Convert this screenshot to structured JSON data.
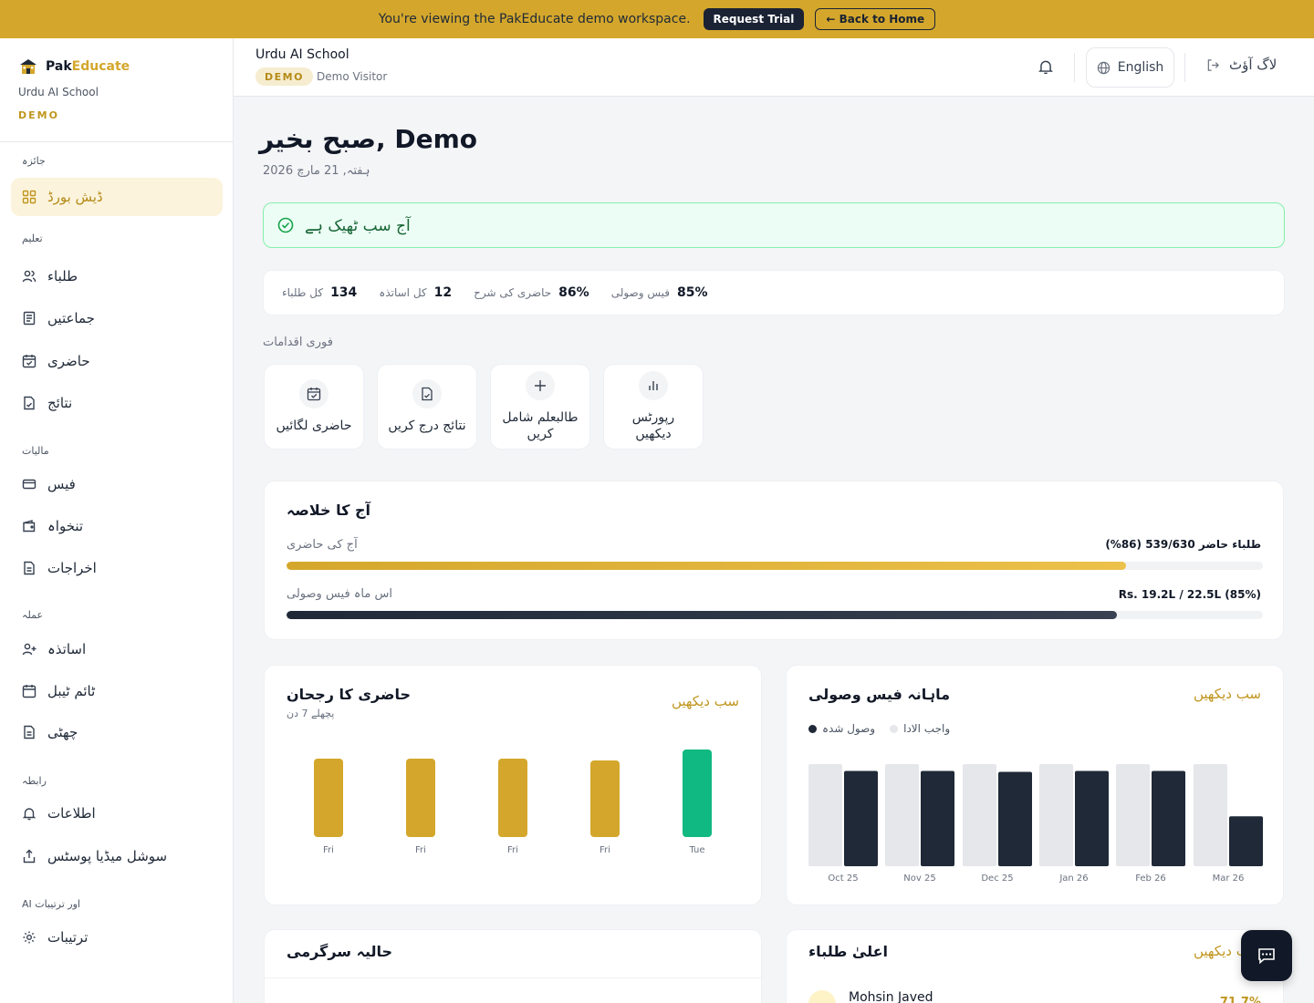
{
  "banner": {
    "message": "You're viewing the PakEducate demo workspace.",
    "request_trial": "Request Trial",
    "back_home": "← Back to Home"
  },
  "brand": {
    "name_part1": "Pak",
    "name_part2": "Educate",
    "school": "Urdu AI School",
    "badge": "DEMO"
  },
  "sidebar": {
    "sections": {
      "overview": "جائزہ",
      "education": "تعلیم",
      "finance": "مالیات",
      "staff": "عملہ",
      "contact": "رابطہ",
      "settings": "AI اور ترتیبات"
    },
    "items": {
      "dashboard": "ڈیش بورڈ",
      "students": "طلباء",
      "classes": "جماعتیں",
      "attendance": "حاضری",
      "results": "نتائج",
      "fees": "فیس",
      "salary": "تنخواہ",
      "expenses": "اخراجات",
      "teachers": "اساتذہ",
      "timetable": "ٹائم ٹیبل",
      "leave": "چھٹی",
      "notifications": "اطلاعات",
      "social": "سوشل میڈیا پوسٹس",
      "settings": "ترتیبات"
    }
  },
  "header": {
    "school": "Urdu AI School",
    "badge": "DEMO",
    "visitor": "Demo Visitor",
    "language": "English",
    "logout": "لاگ آؤٹ"
  },
  "greeting": {
    "text": "صبح بخیر, Demo",
    "date": "ہفتہ, 21 مارچ 2026"
  },
  "status_banner": "آج سب ٹھیک ہے",
  "stats": [
    {
      "label": "کل طلباء",
      "value": "134"
    },
    {
      "label": "کل اساتذہ",
      "value": "12"
    },
    {
      "label": "حاضری کی شرح",
      "value": "86%"
    },
    {
      "label": "فیس وصولی",
      "value": "85%"
    }
  ],
  "quick_actions": {
    "title": "فوری اقدامات",
    "items": [
      "حاضری لگائیں",
      "نتائج درج کریں",
      "طالبعلم شامل کریں",
      "رپورٹس دیکھیں"
    ]
  },
  "summary": {
    "title": "آج کا خلاصہ",
    "attendance_label": "آج کی حاضری",
    "attendance_value": "طلباء حاضر 539/630 (86%)",
    "attendance_fraction": 0.86,
    "fees_label": "اس ماہ فیس وصولی",
    "fees_value": "Rs. 19.2L / 22.5L (85%)",
    "fees_fraction": 0.85
  },
  "attendance_chart": {
    "title": "حاضری کا رجحان",
    "subtitle": "پچھلے 7 دن",
    "see_all": "سب دیکھیں"
  },
  "fees_chart": {
    "title": "ماہانہ فیس وصولی",
    "see_all": "سب دیکھیں",
    "legend_collected": "وصول شدہ",
    "legend_due": "واجب الادا"
  },
  "chart_data": [
    {
      "type": "bar",
      "categories": [
        "Fri",
        "Fri",
        "Fri",
        "Fri",
        "Tue"
      ],
      "values": [
        86,
        86,
        86,
        84,
        96
      ],
      "ylim": [
        0,
        100
      ],
      "colors": [
        "#d4a72c",
        "#d4a72c",
        "#d4a72c",
        "#d4a72c",
        "#10b981"
      ]
    },
    {
      "type": "bar",
      "categories": [
        "Oct 25",
        "Nov 25",
        "Dec 25",
        "Jan 26",
        "Feb 26",
        "Mar 26"
      ],
      "series": [
        {
          "name": "واجب الادا",
          "values": [
            22.5,
            22.5,
            22.5,
            22.5,
            22.5,
            22.5
          ],
          "color": "#e5e7eb"
        },
        {
          "name": "وصول شدہ",
          "values": [
            21.0,
            21.0,
            20.8,
            21.0,
            21.0,
            11.0
          ],
          "color": "#1f2937"
        }
      ],
      "ylim": [
        0,
        22.5
      ]
    }
  ],
  "activity": {
    "title": "حالیہ سرگرمی"
  },
  "top_students": {
    "title": "اعلیٰ طلباء",
    "see_all": "سب دیکھیں",
    "first_name": "Mohsin Javed",
    "first_pct": "71.7%"
  },
  "colors": {
    "accent": "#d4a72c",
    "dark": "#1f2937",
    "success": "#10b981"
  }
}
